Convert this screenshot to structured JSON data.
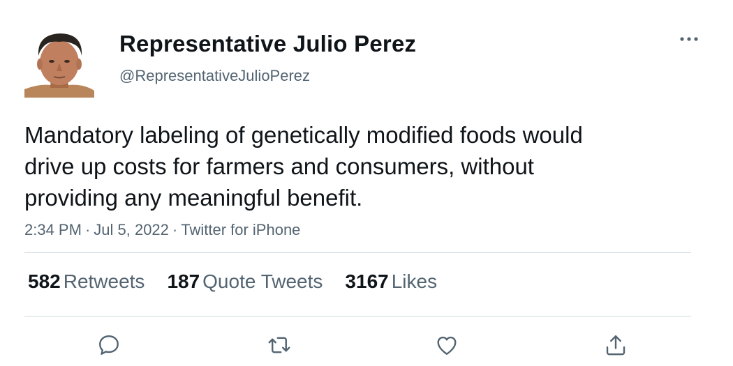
{
  "author": {
    "display_name": "Representative Julio Perez",
    "handle": "@RepresentativeJulioPerez",
    "avatar_icon": "person-portrait"
  },
  "tweet": {
    "text": "Mandatory labeling of genetically modified foods would\ndrive up costs for farmers and consumers, without\nproviding any meaningful benefit.",
    "time": "2:34 PM",
    "date": "Jul 5, 2022",
    "source": "Twitter for iPhone",
    "separator": "·"
  },
  "stats": {
    "retweets": {
      "count": "582",
      "label": "Retweets"
    },
    "quote_tweets": {
      "count": "187",
      "label": "Quote Tweets"
    },
    "likes": {
      "count": "3167",
      "label": "Likes"
    }
  },
  "actions": {
    "reply_icon": "reply-icon",
    "retweet_icon": "retweet-icon",
    "like_icon": "like-icon",
    "share_icon": "share-icon"
  },
  "colors": {
    "text_primary": "#0f1419",
    "text_secondary": "#536471",
    "divider": "#cfd9de"
  }
}
